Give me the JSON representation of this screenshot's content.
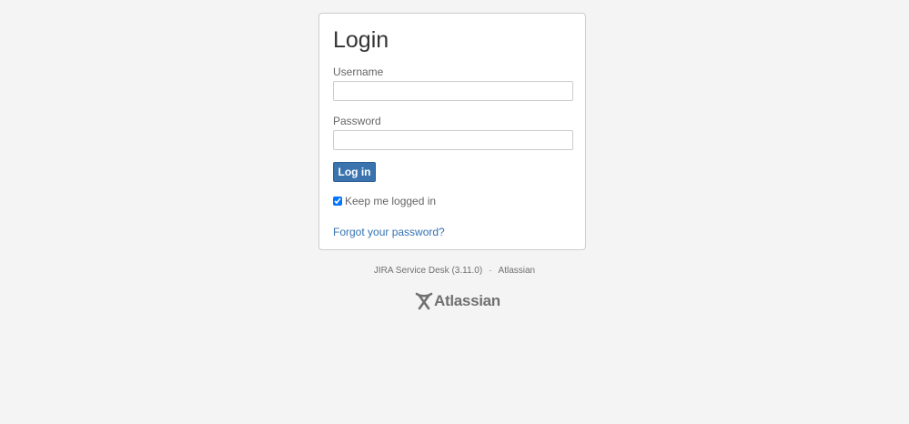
{
  "login": {
    "title": "Login",
    "username_label": "Username",
    "username_value": "",
    "password_label": "Password",
    "password_value": "",
    "submit_label": "Log in",
    "remember_label": "Keep me logged in",
    "remember_checked": true,
    "forgot_label": "Forgot your password?"
  },
  "footer": {
    "product": "JIRA Service Desk (3.11.0)",
    "separator": "·",
    "vendor": "Atlassian"
  },
  "logo": {
    "icon": "atlassian-logo-icon",
    "text": "Atlassian"
  },
  "colors": {
    "background": "#f4f4f4",
    "primary_button": "#3b73af",
    "link": "#3572b0"
  }
}
